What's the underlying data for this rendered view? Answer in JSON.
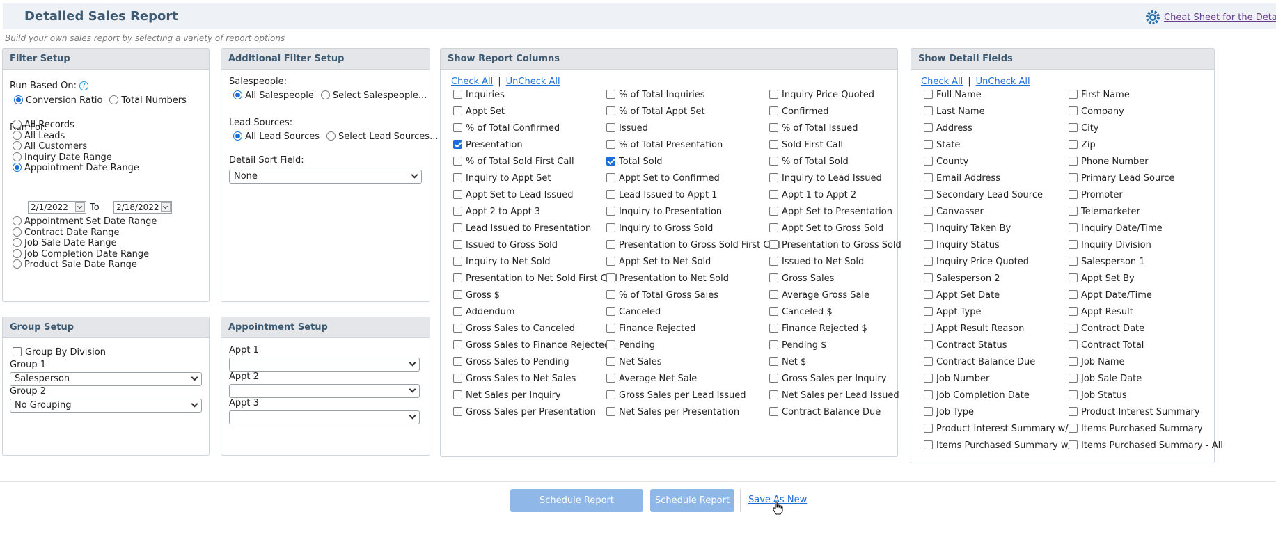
{
  "header": {
    "title": "Detailed Sales Report",
    "subtitle": "Build your own sales report by selecting a variety of report options",
    "cheat_sheet_link": "Cheat Sheet for the Detailed"
  },
  "filter_setup": {
    "title": "Filter Setup",
    "run_based_on_label": "Run Based On:",
    "help_glyph": "?",
    "run_based_on": [
      {
        "label": "Conversion Ratio",
        "selected": true
      },
      {
        "label": "Total Numbers",
        "selected": false
      }
    ],
    "run_for_label": "Run For:",
    "run_for_top": [
      {
        "label": "All Records",
        "selected": false
      },
      {
        "label": "All Leads",
        "selected": false
      },
      {
        "label": "All Customers",
        "selected": false
      },
      {
        "label": "Inquiry Date Range",
        "selected": false
      },
      {
        "label": "Appointment Date Range",
        "selected": true
      }
    ],
    "date_from": "2/1/2022",
    "date_to_label": "To",
    "date_to": "2/18/2022",
    "run_for_bottom": [
      {
        "label": "Appointment Set Date Range",
        "selected": false
      },
      {
        "label": "Contract Date Range",
        "selected": false
      },
      {
        "label": "Job Sale Date Range",
        "selected": false
      },
      {
        "label": "Job Completion Date Range",
        "selected": false
      },
      {
        "label": "Product Sale Date Range",
        "selected": false
      }
    ]
  },
  "additional_filter": {
    "title": "Additional Filter Setup",
    "salespeople_label": "Salespeople:",
    "salespeople": [
      {
        "label": "All Salespeople",
        "selected": true
      },
      {
        "label": "Select Salespeople...",
        "selected": false
      }
    ],
    "lead_sources_label": "Lead Sources:",
    "lead_sources": [
      {
        "label": "All Lead Sources",
        "selected": true
      },
      {
        "label": "Select Lead Sources...",
        "selected": false
      }
    ],
    "sort_label": "Detail Sort Field:",
    "sort_value": "None"
  },
  "group_setup": {
    "title": "Group Setup",
    "group_by_division": "Group By Division",
    "group1_label": "Group 1",
    "group1_value": "Salesperson",
    "group2_label": "Group 2",
    "group2_value": "No Grouping"
  },
  "appointment_setup": {
    "title": "Appointment Setup",
    "appt1_label": "Appt 1",
    "appt2_label": "Appt 2",
    "appt3_label": "Appt 3"
  },
  "report_columns": {
    "title": "Show Report Columns",
    "check_all": "Check All",
    "uncheck_all": "UnCheck All",
    "divider": "|",
    "checked": [
      "Presentation",
      "Total Sold"
    ],
    "col1": [
      "Inquiries",
      "Appt Set",
      "% of Total Confirmed",
      "Presentation",
      "% of Total Sold First Call",
      "Inquiry to Appt Set",
      "Appt Set to Lead Issued",
      "Appt 2 to Appt 3",
      "Lead Issued to Presentation",
      "Issued to Gross Sold",
      "Inquiry to Net Sold",
      "Presentation to Net Sold First Call",
      "Gross $",
      "Addendum",
      "Gross Sales to Canceled",
      "Gross Sales to Finance Rejected",
      "Gross Sales to Pending",
      "Gross Sales to Net Sales",
      "Net Sales per Inquiry",
      "Gross Sales per Presentation"
    ],
    "col2": [
      "% of Total Inquiries",
      "% of Total Appt Set",
      "Issued",
      "% of Total Presentation",
      "Total Sold",
      "Appt Set to Confirmed",
      "Lead Issued to Appt 1",
      "Inquiry to Presentation",
      "Inquiry to Gross Sold",
      "Presentation to Gross Sold First Call",
      "Appt Set to Net Sold",
      "Presentation to Net Sold",
      "% of Total Gross Sales",
      "Canceled",
      "Finance Rejected",
      "Pending",
      "Net Sales",
      "Average Net Sale",
      "Gross Sales per Lead Issued",
      "Net Sales per Presentation"
    ],
    "col3": [
      "Inquiry Price Quoted",
      "Confirmed",
      "% of Total Issued",
      "Sold First Call",
      "% of Total Sold",
      "Inquiry to Lead Issued",
      "Appt 1 to Appt 2",
      "Appt Set to Presentation",
      "Appt Set to Gross Sold",
      "Presentation to Gross Sold",
      "Issued to Net Sold",
      "Gross Sales",
      "Average Gross Sale",
      "Canceled $",
      "Finance Rejected $",
      "Pending $",
      "Net $",
      "Gross Sales per Inquiry",
      "Net Sales per Lead Issued",
      "Contract Balance Due"
    ]
  },
  "detail_fields": {
    "title": "Show Detail Fields",
    "check_all": "Check All",
    "uncheck_all": "UnCheck All",
    "divider": "|",
    "col1": [
      "Full Name",
      "Last Name",
      "Address",
      "State",
      "County",
      "Email Address",
      "Secondary Lead Source",
      "Canvasser",
      "Inquiry Taken By",
      "Inquiry Status",
      "Inquiry Price Quoted",
      "Salesperson 2",
      "Appt Set Date",
      "Appt Type",
      "Appt Result Reason",
      "Contract Status",
      "Contract Balance Due",
      "Job Number",
      "Job Completion Date",
      "Job Type",
      "Product Interest Summary w/$",
      "Items Purchased Summary w/$"
    ],
    "col2": [
      "First Name",
      "Company",
      "City",
      "Zip",
      "Phone Number",
      "Primary Lead Source",
      "Promoter",
      "Telemarketer",
      "Inquiry Date/Time",
      "Inquiry Division",
      "Salesperson 1",
      "Appt Set By",
      "Appt Date/Time",
      "Appt Result",
      "Contract Date",
      "Contract Total",
      "Job Name",
      "Job Sale Date",
      "Job Status",
      "Product Interest Summary",
      "Items Purchased Summary",
      "Items Purchased Summary - All"
    ]
  },
  "footer": {
    "schedule_immediately": "Schedule Report Immediately",
    "schedule": "Schedule Report",
    "save_as_new": "Save As New"
  },
  "colors": {
    "accent": "#1a6ed6",
    "header_text": "#3d5a73",
    "button": "#8fb8e8"
  }
}
